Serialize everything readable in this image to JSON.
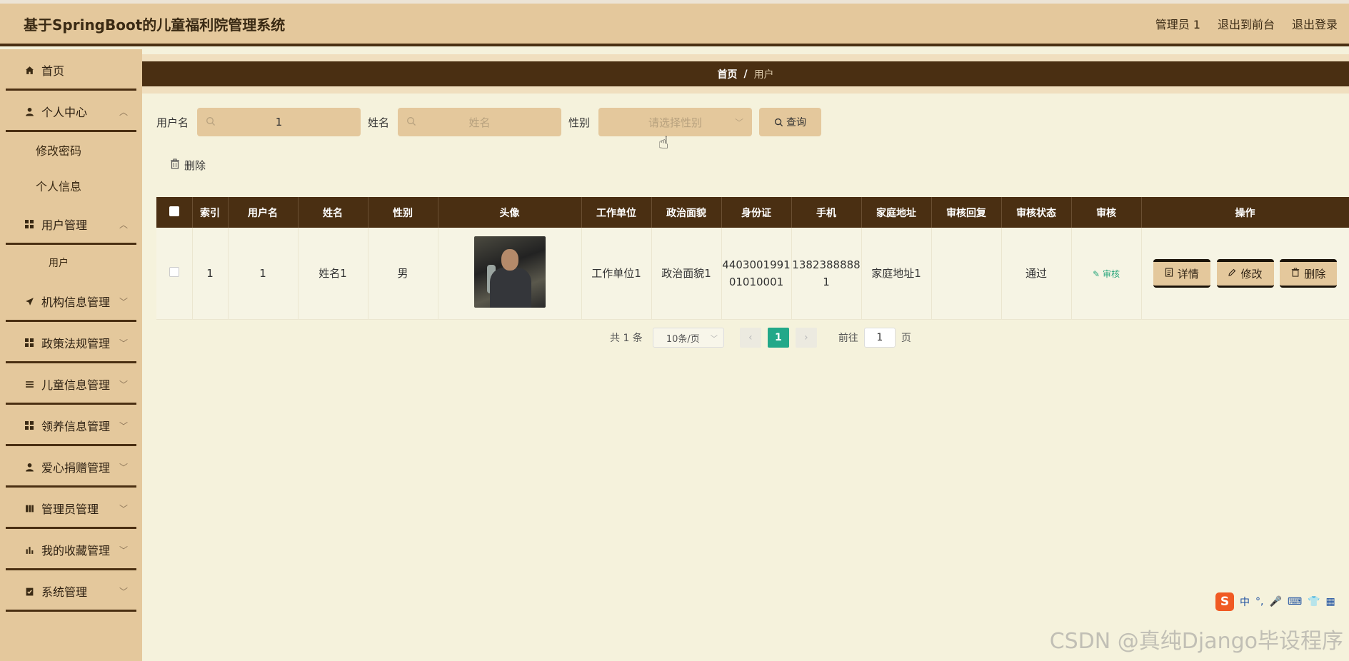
{
  "header": {
    "title": "基于SpringBoot的儿童福利院管理系统",
    "admin_label": "管理员 1",
    "to_front": "退出到前台",
    "logout": "退出登录"
  },
  "sidebar": {
    "items": [
      {
        "label": "首页",
        "icon": "home-icon"
      },
      {
        "label": "个人中心",
        "icon": "user-icon",
        "children": [
          "修改密码",
          "个人信息"
        ]
      },
      {
        "label": "用户管理",
        "icon": "grid-icon",
        "children": [
          "用户"
        ]
      },
      {
        "label": "机构信息管理",
        "icon": "send-icon"
      },
      {
        "label": "政策法规管理",
        "icon": "grid-icon"
      },
      {
        "label": "儿童信息管理",
        "icon": "list-icon"
      },
      {
        "label": "领养信息管理",
        "icon": "grid-icon"
      },
      {
        "label": "爱心捐赠管理",
        "icon": "user-icon"
      },
      {
        "label": "管理员管理",
        "icon": "book-icon"
      },
      {
        "label": "我的收藏管理",
        "icon": "bar-chart-icon"
      },
      {
        "label": "系统管理",
        "icon": "clipboard-icon"
      }
    ]
  },
  "breadcrumb": {
    "home": "首页",
    "sep": "/",
    "current": "用户"
  },
  "search": {
    "username_label": "用户名",
    "username_value": "1",
    "name_label": "姓名",
    "name_placeholder": "姓名",
    "gender_label": "性别",
    "gender_placeholder": "请选择性别",
    "query_button": "查询"
  },
  "actions": {
    "delete": "删除"
  },
  "table": {
    "columns": [
      "索引",
      "用户名",
      "姓名",
      "性别",
      "头像",
      "工作单位",
      "政治面貌",
      "身份证",
      "手机",
      "家庭地址",
      "审核回复",
      "审核状态",
      "审核",
      "操作"
    ],
    "rows": [
      {
        "index": "1",
        "username": "1",
        "name": "姓名1",
        "gender": "男",
        "work": "工作单位1",
        "politics": "政治面貌1",
        "id_card": "440300199101010001",
        "phone": "13823888881",
        "address": "家庭地址1",
        "reply": "",
        "status": "通过",
        "audit": "审核",
        "op_detail": "详情",
        "op_edit": "修改",
        "op_delete": "删除"
      }
    ]
  },
  "pagination": {
    "total": "共 1 条",
    "page_size": "10条/页",
    "current": "1",
    "goto_label": "前往",
    "goto_value": "1",
    "page_unit": "页"
  },
  "ime": {
    "lang": "中",
    "punct": "°,"
  },
  "watermark": "CSDN @真纯Django毕设程序",
  "colors": {
    "header_bg": "#e4c89c",
    "dark_brown": "#4a2f12",
    "page_bg": "#f5f2dc",
    "active_page": "#22a889"
  }
}
